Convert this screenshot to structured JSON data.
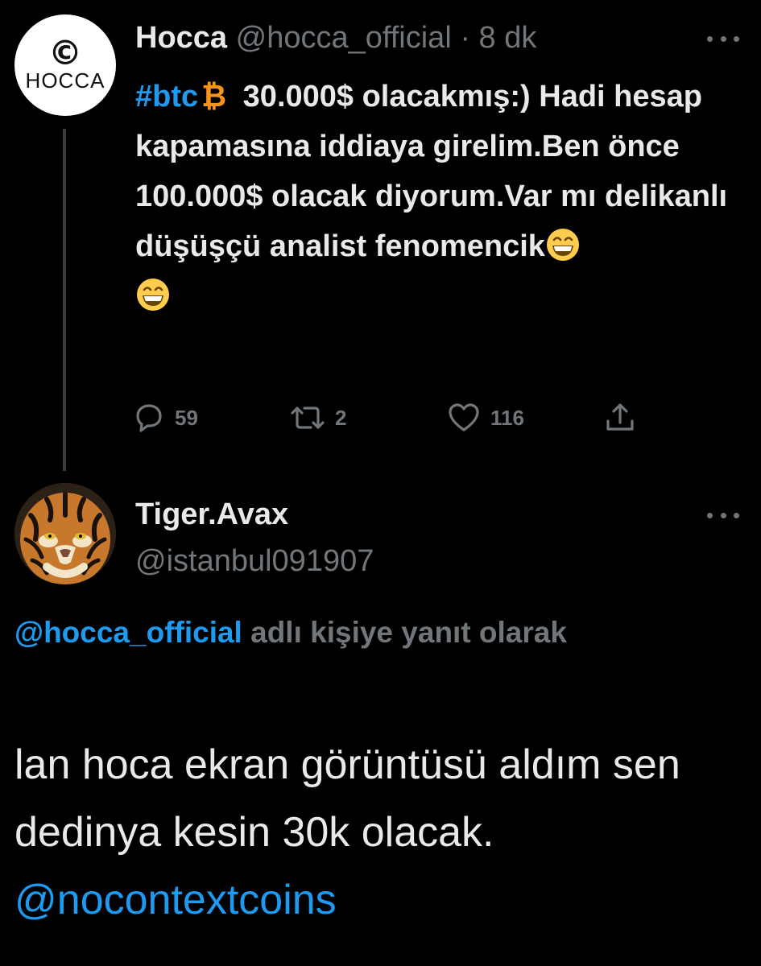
{
  "tweet1": {
    "avatar_logo_mark": "©",
    "avatar_logo_text": "HOCCA",
    "name": "Hocca",
    "handle": "@hocca_official",
    "separator": "·",
    "time": "8 dk",
    "hashtag": "#btc",
    "btc_symbol": "₿",
    "text_line1_rest": "30.000$ olacakmış:)",
    "text_body": "Hadi hesap kapamasına iddiaya girelim.Ben önce 100.000$ olacak diyorum.Var mı delikanlı düşüşçü analist fenomencik",
    "emoji": "grinning-face-with-smiling-eyes",
    "actions": {
      "reply_count": "59",
      "retweet_count": "2",
      "like_count": "116"
    }
  },
  "tweet2": {
    "name": "Tiger.Avax",
    "handle": "@istanbul091907",
    "reply_mention": "@hocca_official",
    "reply_suffix": " adlı kişiye yanıt olarak",
    "body_text": "lan hoca ekran görüntüsü aldım sen dedinya kesin 30k olacak. ",
    "body_mention": "@nocontextcoins"
  },
  "colors": {
    "background": "#000000",
    "text": "#e7e9ea",
    "muted": "#71767b",
    "link": "#1d9bf0",
    "bitcoin": "#f7931a"
  }
}
